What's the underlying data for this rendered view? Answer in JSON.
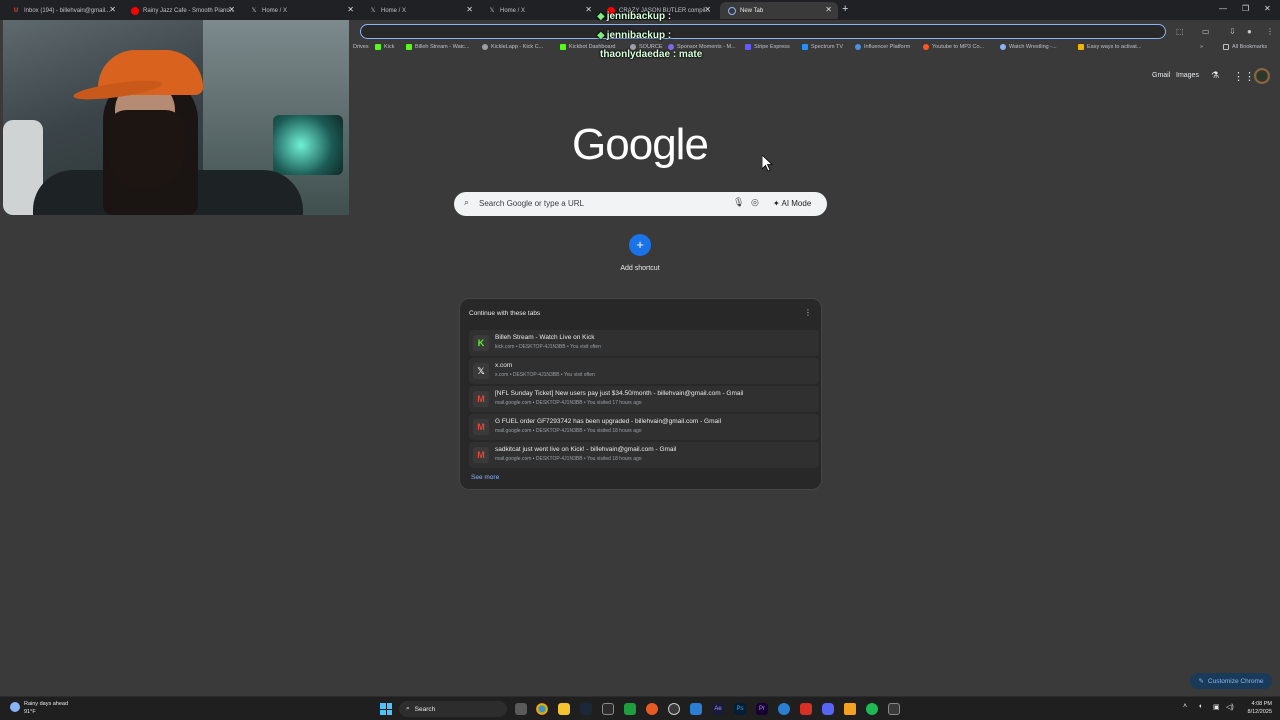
{
  "tabs": [
    {
      "label": "Inbox (194) - billehvain@gmail...",
      "icon": "gmail-icon",
      "color": "#ea4335"
    },
    {
      "label": "Rainy Jazz Cafe - Smooth Piano...",
      "icon": "youtube-icon",
      "color": "#ff0000"
    },
    {
      "label": "Home / X",
      "icon": "x-icon",
      "color": "#ffffff"
    },
    {
      "label": "Home / X",
      "icon": "x-icon",
      "color": "#ffffff"
    },
    {
      "label": "Home / X",
      "icon": "x-icon",
      "color": "#ffffff"
    },
    {
      "label": "CRAZY JASON BUTLER compil...",
      "icon": "youtube-icon",
      "color": "#ff0000"
    },
    {
      "label": "New Tab",
      "icon": "chrome-icon",
      "color": "#8ab4f8"
    }
  ],
  "bookmarks": [
    {
      "label": "Drives",
      "color": "#4a90e2"
    },
    {
      "label": "Kick",
      "color": "#53fc18"
    },
    {
      "label": "Billeh Stream - Watc...",
      "color": "#53fc18"
    },
    {
      "label": "KickleLapp - Kick C...",
      "color": "#9aa0a6"
    },
    {
      "label": "Kickbot Dashboard",
      "color": "#53fc18"
    },
    {
      "label": "SOURCE",
      "color": "#9aa0a6"
    },
    {
      "label": "Sponsor Moments - M...",
      "color": "#7b68ee"
    },
    {
      "label": "Stripe Express",
      "color": "#635bff"
    },
    {
      "label": "Spectrum TV",
      "color": "#1e90ff"
    },
    {
      "label": "Influencer Platform",
      "color": "#4a90e2"
    },
    {
      "label": "Youtube to MP3 Co...",
      "color": "#ff5722"
    },
    {
      "label": "Watch Wrestling -...",
      "color": "#8ab4f8"
    },
    {
      "label": "Easy ways to activat...",
      "color": "#f4b400"
    }
  ],
  "all_bookmarks": "All Bookmarks",
  "chat": [
    {
      "user": "jennibackup",
      "msg": ":"
    },
    {
      "user": "jennibackup",
      "msg": ":"
    },
    {
      "user": "thaonlydaedae",
      "msg": ": mate"
    }
  ],
  "header": {
    "gmail": "Gmail",
    "images": "Images"
  },
  "logo": "Google",
  "search": {
    "placeholder": "Search Google or type a URL",
    "ai_mode": "AI Mode"
  },
  "shortcut": {
    "label": "Add shortcut"
  },
  "continue_card": {
    "title": "Continue with these tabs",
    "items": [
      {
        "title": "Billeh Stream - Watch Live on Kick",
        "sub": "kick.com • DESKTOP-4J1N3BB • You visit often",
        "icon": "kick-icon",
        "glyph": "K",
        "color": "#53fc18"
      },
      {
        "title": "x.com",
        "sub": "x.com • DESKTOP-4J1N3BB • You visit often",
        "icon": "x-icon",
        "glyph": "𝕏",
        "color": "#ffffff"
      },
      {
        "title": "[NFL Sunday Ticket] New users pay just $34.50/month - billehvain@gmail.com - Gmail",
        "sub": "mail.google.com • DESKTOP-4J1N3BB • You visited 17 hours ago",
        "icon": "gmail-icon",
        "glyph": "M",
        "color": "#ea4335"
      },
      {
        "title": "G FUEL order GF7293742 has been upgraded - billehvain@gmail.com - Gmail",
        "sub": "mail.google.com • DESKTOP-4J1N3BB • You visited 18 hours ago",
        "icon": "gmail-icon",
        "glyph": "M",
        "color": "#ea4335"
      },
      {
        "title": "sadkitcat just went live on Kick! - billehvain@gmail.com - Gmail",
        "sub": "mail.google.com • DESKTOP-4J1N3BB • You visited 18 hours ago",
        "icon": "gmail-icon",
        "glyph": "M",
        "color": "#ea4335"
      }
    ],
    "see_more": "See more"
  },
  "customize": "Customize Chrome",
  "taskbar": {
    "weather_line1": "Rainy days ahead",
    "weather_line2": "91°F",
    "search": "Search",
    "time": "4:08 PM",
    "date": "8/12/2025"
  }
}
